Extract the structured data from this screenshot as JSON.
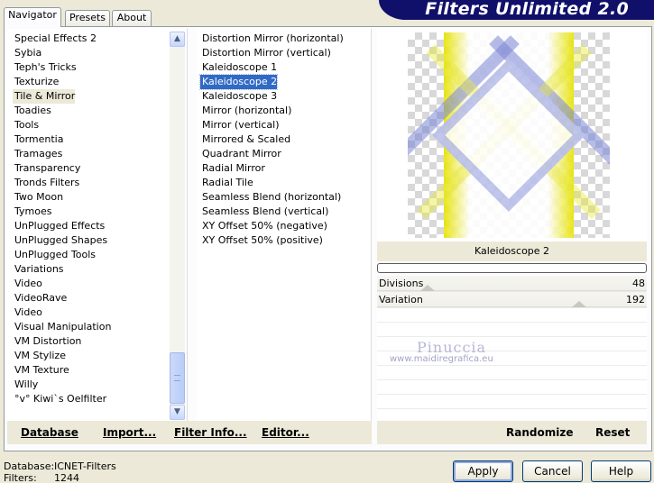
{
  "banner": {
    "title": "Filters Unlimited 2.0"
  },
  "tabs": [
    {
      "label": "Navigator",
      "active": true
    },
    {
      "label": "Presets",
      "active": false
    },
    {
      "label": "About",
      "active": false
    }
  ],
  "categories": {
    "items": [
      "Special Effects 2",
      "Sybia",
      "Teph's Tricks",
      "Texturize",
      "Tile & Mirror",
      "Toadies",
      "Tools",
      "Tormentia",
      "Tramages",
      "Transparency",
      "Tronds Filters",
      "Two Moon",
      "Tymoes",
      "UnPlugged Effects",
      "UnPlugged Shapes",
      "UnPlugged Tools",
      "Variations",
      "Video",
      "VideoRave",
      "Video",
      "Visual Manipulation",
      "VM Distortion",
      "VM Stylize",
      "VM Texture",
      "Willy",
      "°v° Kiwi`s Oelfilter"
    ],
    "selected": "Tile & Mirror"
  },
  "filters": {
    "items": [
      "Distortion Mirror (horizontal)",
      "Distortion Mirror (vertical)",
      "Kaleidoscope 1",
      "Kaleidoscope 2",
      "Kaleidoscope 3",
      "Mirror (horizontal)",
      "Mirror (vertical)",
      "Mirrored & Scaled",
      "Quadrant Mirror",
      "Radial Mirror",
      "Radial Tile",
      "Seamless Blend (horizontal)",
      "Seamless Blend (vertical)",
      "XY Offset 50% (negative)",
      "XY Offset 50% (positive)"
    ],
    "selected": "Kaleidoscope 2"
  },
  "preview": {
    "filter_name": "Kaleidoscope 2",
    "progress": 0
  },
  "sliders": [
    {
      "label": "Divisions",
      "value": "48"
    },
    {
      "label": "Variation",
      "value": "192"
    }
  ],
  "watermark": {
    "name": "Pinuccia",
    "url": "www.maidiregrafica.eu"
  },
  "toolbar": {
    "database": "Database",
    "import": "Import...",
    "filter_info": "Filter Info...",
    "editor": "Editor...",
    "randomize": "Randomize",
    "reset": "Reset"
  },
  "status": {
    "database_label": "Database:",
    "database_value": "ICNET-Filters",
    "filters_label": "Filters:",
    "filters_value": "1244"
  },
  "buttons": {
    "apply": "Apply",
    "cancel": "Cancel",
    "help": "Help"
  },
  "colors": {
    "selection": "#316ac5",
    "banner": "#10106a",
    "face": "#ece9d8"
  }
}
